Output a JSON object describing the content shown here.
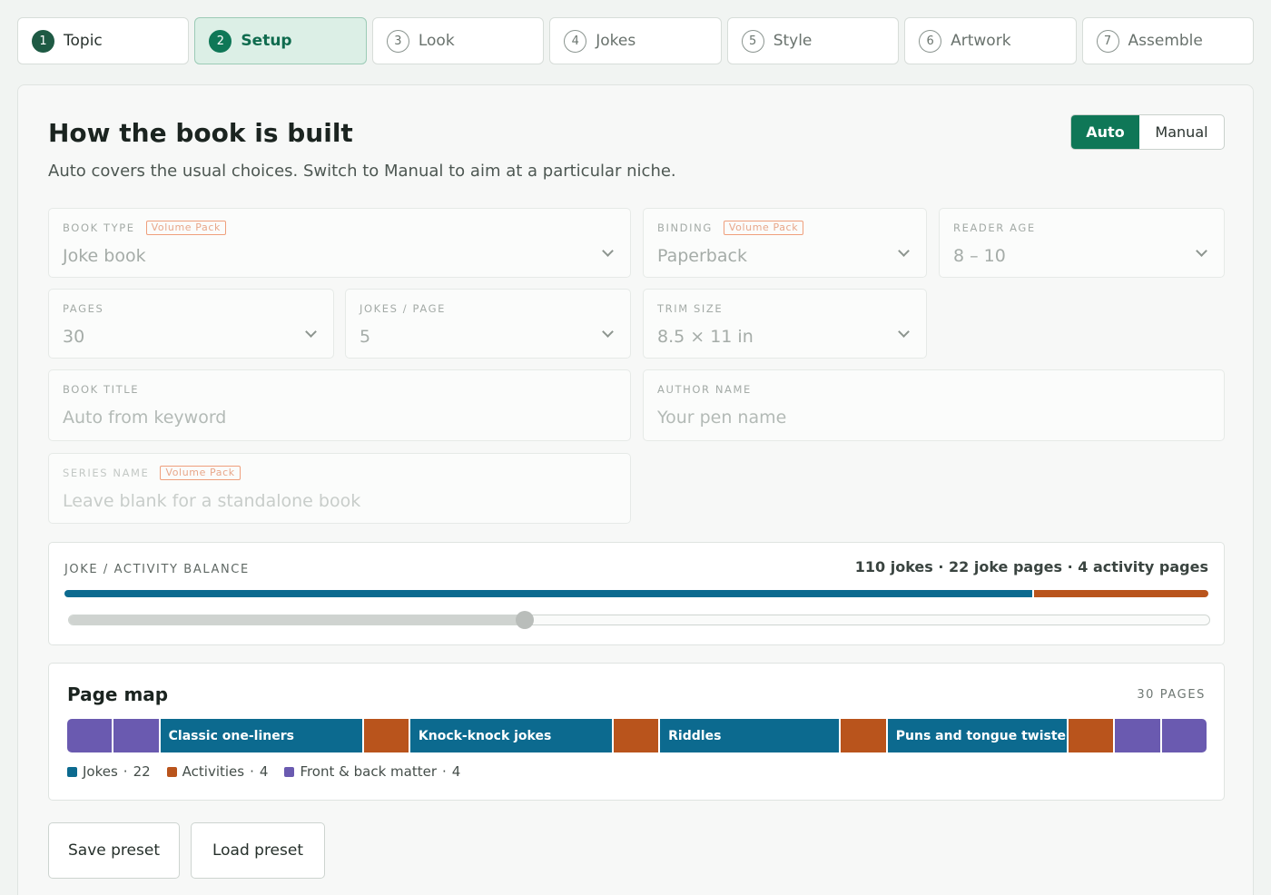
{
  "steps": [
    {
      "num": "1",
      "label": "Topic",
      "state": "done"
    },
    {
      "num": "2",
      "label": "Setup",
      "state": "active"
    },
    {
      "num": "3",
      "label": "Look",
      "state": "todo"
    },
    {
      "num": "4",
      "label": "Jokes",
      "state": "todo"
    },
    {
      "num": "5",
      "label": "Style",
      "state": "todo"
    },
    {
      "num": "6",
      "label": "Artwork",
      "state": "todo"
    },
    {
      "num": "7",
      "label": "Assemble",
      "state": "todo"
    }
  ],
  "header": {
    "title": "How the book is built",
    "subtitle": "Auto covers the usual choices. Switch to Manual to aim at a particular niche.",
    "mode_auto": "Auto",
    "mode_manual": "Manual",
    "mode_selected": "Auto"
  },
  "fields": {
    "book_type": {
      "label": "BOOK TYPE",
      "badge": "Volume Pack",
      "value": "Joke book"
    },
    "binding": {
      "label": "BINDING",
      "badge": "Volume Pack",
      "value": "Paperback"
    },
    "reader_age": {
      "label": "READER AGE",
      "value": "8 – 10"
    },
    "pages": {
      "label": "PAGES",
      "value": "30"
    },
    "jokes_per_page": {
      "label": "JOKES / PAGE",
      "value": "5"
    },
    "trim_size": {
      "label": "TRIM SIZE",
      "value": "8.5 × 11 in"
    },
    "book_title": {
      "label": "BOOK TITLE",
      "placeholder": "Auto from keyword"
    },
    "author_name": {
      "label": "AUTHOR NAME",
      "placeholder": "Your pen name"
    },
    "series_name": {
      "label": "SERIES NAME",
      "badge": "Volume Pack",
      "placeholder": "Leave blank for a standalone book"
    }
  },
  "balance": {
    "label": "JOKE / ACTIVITY BALANCE",
    "summary": "110 jokes · 22 joke pages · 4 activity pages",
    "joke_pages": 22,
    "activity_pages": 4,
    "slider_fraction": 0.4
  },
  "page_map": {
    "title": "Page map",
    "page_count_label": "30 PAGES",
    "segments": [
      {
        "kind": "front",
        "pages": 1,
        "label": ""
      },
      {
        "kind": "front",
        "pages": 1,
        "label": ""
      },
      {
        "kind": "joke",
        "pages": 4.5,
        "label": "Classic one-liners"
      },
      {
        "kind": "act",
        "pages": 1,
        "label": ""
      },
      {
        "kind": "joke",
        "pages": 4.5,
        "label": "Knock-knock jokes"
      },
      {
        "kind": "act",
        "pages": 1,
        "label": ""
      },
      {
        "kind": "joke",
        "pages": 4,
        "label": "Riddles"
      },
      {
        "kind": "act",
        "pages": 1,
        "label": ""
      },
      {
        "kind": "joke",
        "pages": 4,
        "label": "Puns and tongue twisters"
      },
      {
        "kind": "act",
        "pages": 1,
        "label": ""
      },
      {
        "kind": "front",
        "pages": 1,
        "label": ""
      },
      {
        "kind": "front",
        "pages": 1,
        "label": ""
      }
    ],
    "legend": [
      {
        "kind": "joke",
        "label": "Jokes",
        "count": "22"
      },
      {
        "kind": "act",
        "label": "Activities",
        "count": "4"
      },
      {
        "kind": "front",
        "label": "Front & back matter",
        "count": "4"
      }
    ]
  },
  "colors": {
    "accent": "#0f7757",
    "jokes": "#0c6a8f",
    "activities": "#b9541c",
    "front_matter": "#6a5ab0"
  },
  "buttons": {
    "save_preset": "Save preset",
    "load_preset": "Load preset"
  }
}
